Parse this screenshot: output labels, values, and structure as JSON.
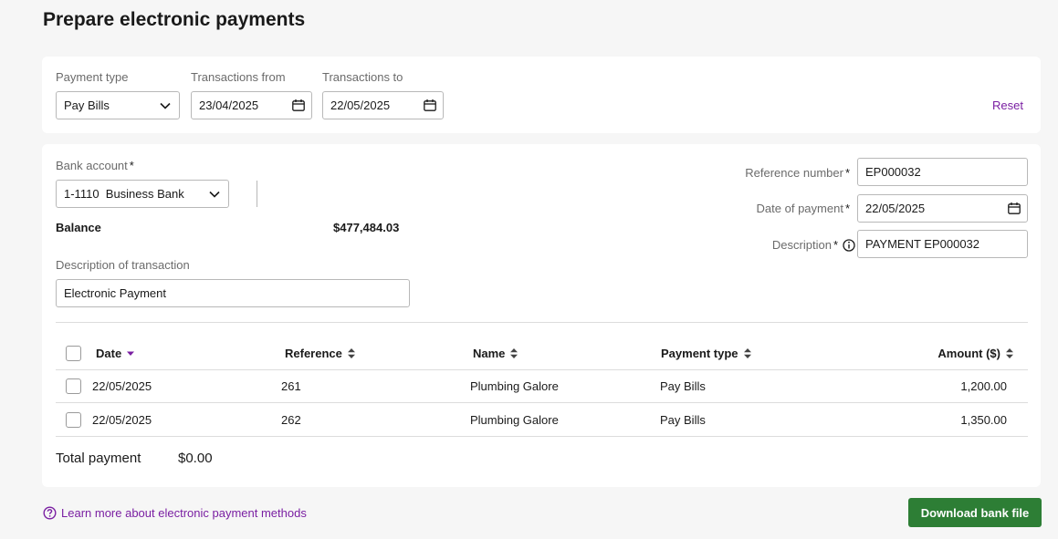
{
  "page": {
    "title": "Prepare electronic payments"
  },
  "filters": {
    "payment_type_label": "Payment type",
    "payment_type_value": "Pay Bills",
    "from_label": "Transactions from",
    "from_value": "23/04/2025",
    "to_label": "Transactions to",
    "to_value": "22/05/2025",
    "reset_label": "Reset"
  },
  "account": {
    "bank_account_label": "Bank account",
    "bank_account_value": "1-1110  Business Bank",
    "balance_label": "Balance",
    "balance_value": "$477,484.03",
    "desc_label": "Description of transaction",
    "desc_value": "Electronic Payment",
    "required_mark": "*"
  },
  "payment": {
    "ref_label": "Reference number",
    "ref_value": "EP000032",
    "date_label": "Date of payment",
    "date_value": "22/05/2025",
    "desc_label": "Description",
    "desc_value": "PAYMENT EP000032"
  },
  "table": {
    "headers": {
      "date": "Date",
      "reference": "Reference",
      "name": "Name",
      "payment_type": "Payment type",
      "amount": "Amount ($)"
    },
    "rows": [
      {
        "date": "22/05/2025",
        "reference": "261",
        "name": "Plumbing Galore",
        "payment_type": "Pay Bills",
        "amount": "1,200.00"
      },
      {
        "date": "22/05/2025",
        "reference": "262",
        "name": "Plumbing Galore",
        "payment_type": "Pay Bills",
        "amount": "1,350.00"
      }
    ]
  },
  "total": {
    "label": "Total payment",
    "value": "$0.00"
  },
  "footer": {
    "learn_more": "Learn more about electronic payment methods",
    "download_button": "Download bank file"
  },
  "colors": {
    "accent": "#7a1fa2",
    "primary_button": "#2d7e35"
  }
}
